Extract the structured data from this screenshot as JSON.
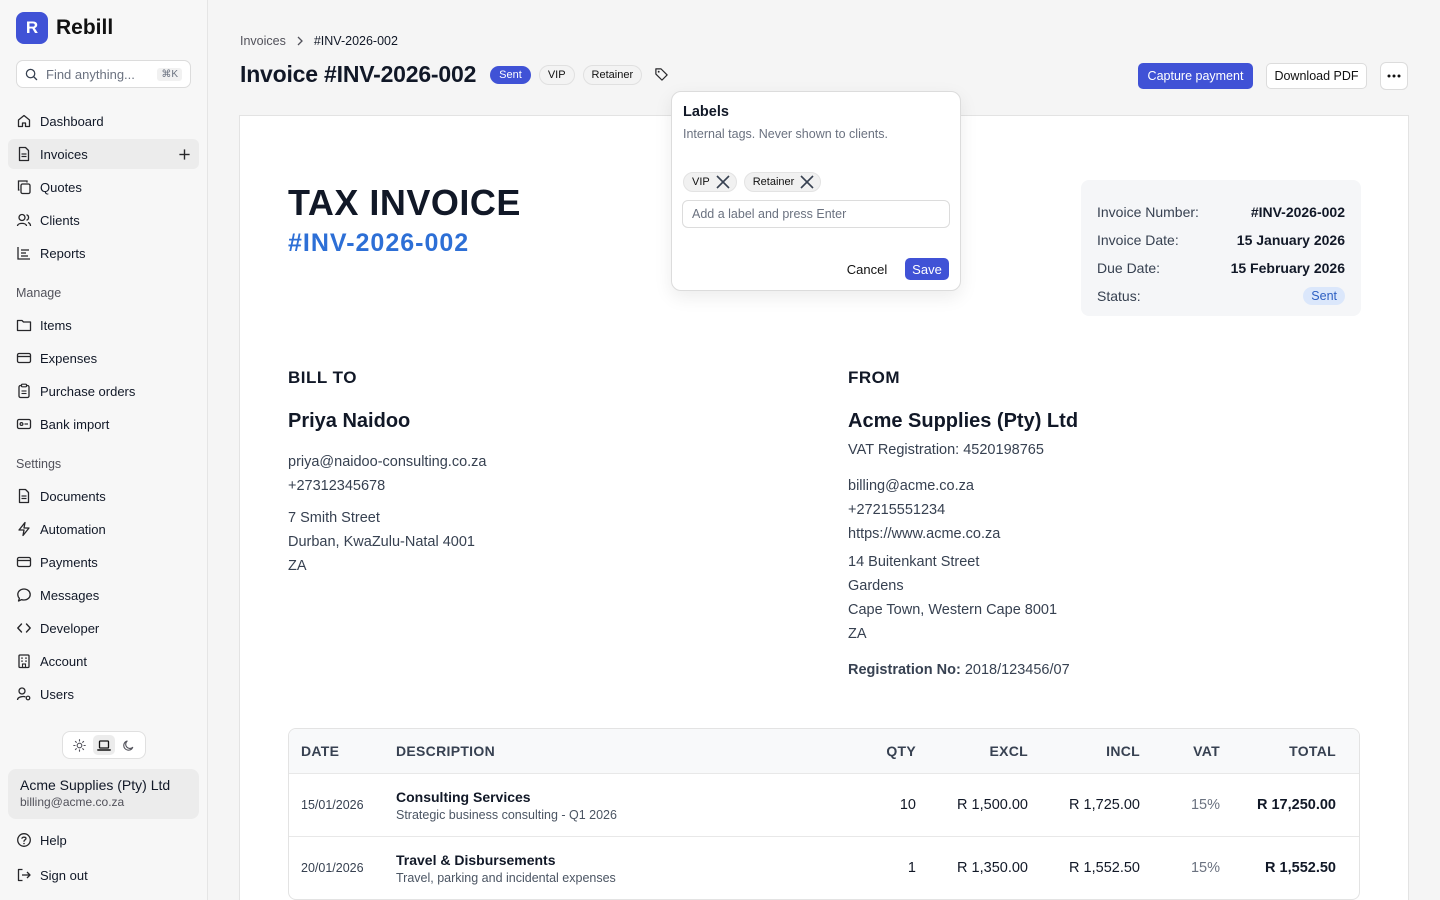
{
  "brand": {
    "logo_letter": "R",
    "name": "Rebill"
  },
  "search": {
    "placeholder": "Find anything...",
    "shortcut": "⌘K"
  },
  "nav": {
    "main": [
      {
        "label": "Dashboard",
        "icon": "home-icon"
      },
      {
        "label": "Invoices",
        "icon": "document-icon",
        "active": true
      },
      {
        "label": "Quotes",
        "icon": "copy-icon"
      },
      {
        "label": "Clients",
        "icon": "users-icon"
      },
      {
        "label": "Reports",
        "icon": "chart-icon"
      }
    ],
    "manage_label": "Manage",
    "manage": [
      {
        "label": "Items",
        "icon": "folder-icon"
      },
      {
        "label": "Expenses",
        "icon": "card-icon"
      },
      {
        "label": "Purchase orders",
        "icon": "clipboard-icon"
      },
      {
        "label": "Bank import",
        "icon": "bank-icon"
      }
    ],
    "settings_label": "Settings",
    "settings": [
      {
        "label": "Documents",
        "icon": "document-icon"
      },
      {
        "label": "Automation",
        "icon": "bolt-icon"
      },
      {
        "label": "Payments",
        "icon": "card-icon"
      },
      {
        "label": "Messages",
        "icon": "chat-icon"
      },
      {
        "label": "Developer",
        "icon": "code-icon"
      },
      {
        "label": "Account",
        "icon": "building-icon"
      },
      {
        "label": "Users",
        "icon": "user-key-icon"
      }
    ],
    "help": "Help",
    "sign_out": "Sign out"
  },
  "account": {
    "name": "Acme Supplies (Pty) Ltd",
    "email": "billing@acme.co.za"
  },
  "breadcrumb": {
    "parent": "Invoices",
    "current": "#INV-2026-002"
  },
  "header": {
    "title": "Invoice #INV-2026-002",
    "status": "Sent",
    "tags": [
      "VIP",
      "Retainer"
    ],
    "capture_payment": "Capture payment",
    "download_pdf": "Download PDF"
  },
  "labels_popover": {
    "title": "Labels",
    "subtitle": "Internal tags. Never shown to clients.",
    "chips": [
      "VIP",
      "Retainer"
    ],
    "input_placeholder": "Add a label and press Enter",
    "cancel": "Cancel",
    "save": "Save"
  },
  "invoice": {
    "heading": "TAX INVOICE",
    "number": "#INV-2026-002",
    "meta": {
      "number_label": "Invoice Number:",
      "number_value": "#INV-2026-002",
      "date_label": "Invoice Date:",
      "date_value": "15 January 2026",
      "due_label": "Due Date:",
      "due_value": "15 February 2026",
      "status_label": "Status:",
      "status_value": "Sent"
    },
    "bill_to": {
      "heading": "BILL TO",
      "name": "Priya Naidoo",
      "email": "priya@naidoo-consulting.co.za",
      "phone": "+27312345678",
      "address": [
        "7 Smith Street",
        "Durban, KwaZulu-Natal 4001",
        "ZA"
      ]
    },
    "from": {
      "heading": "FROM",
      "name": "Acme Supplies (Pty) Ltd",
      "vat": "VAT Registration: 4520198765",
      "email": "billing@acme.co.za",
      "phone": "+27215551234",
      "website": "https://www.acme.co.za",
      "address": [
        "14 Buitenkant Street",
        "Gardens",
        "Cape Town, Western Cape 8001",
        "ZA"
      ],
      "reg_label": "Registration No:",
      "reg_value": "2018/123456/07"
    },
    "table": {
      "headers": {
        "date": "DATE",
        "description": "DESCRIPTION",
        "qty": "QTY",
        "excl": "EXCL",
        "incl": "INCL",
        "vat": "VAT",
        "total": "TOTAL"
      },
      "rows": [
        {
          "date": "15/01/2026",
          "title": "Consulting Services",
          "sub": "Strategic business consulting - Q1 2026",
          "qty": "10",
          "excl": "R 1,500.00",
          "incl": "R 1,725.00",
          "vat": "15%",
          "total": "R 17,250.00"
        },
        {
          "date": "20/01/2026",
          "title": "Travel & Disbursements",
          "sub": "Travel, parking and incidental expenses",
          "qty": "1",
          "excl": "R 1,350.00",
          "incl": "R 1,552.50",
          "vat": "15%",
          "total": "R 1,552.50"
        }
      ]
    }
  },
  "colors": {
    "accent": "#4052d6",
    "invoice_number": "#2d6fd6",
    "status_pill_bg": "#dbe7fb"
  }
}
